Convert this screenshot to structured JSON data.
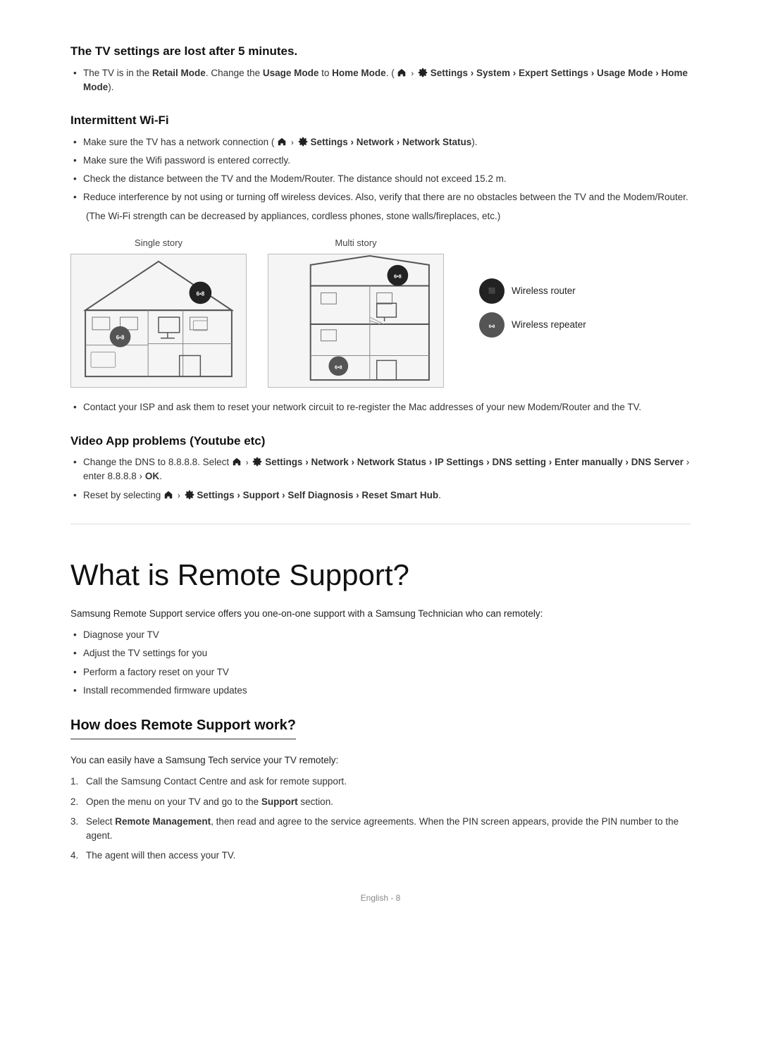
{
  "section_tv_settings": {
    "heading": "The TV settings are lost after 5 minutes.",
    "bullets": [
      {
        "text_parts": [
          {
            "text": "The TV is in the ",
            "bold": false
          },
          {
            "text": "Retail Mode",
            "bold": true
          },
          {
            "text": ". Change the ",
            "bold": false
          },
          {
            "text": "Usage Mode",
            "bold": true
          },
          {
            "text": " to ",
            "bold": false
          },
          {
            "text": "Home Mode",
            "bold": true
          },
          {
            "text": ". (",
            "bold": false
          },
          {
            "text": "home_icon",
            "icon": true
          },
          {
            "text": " > ",
            "bold": false
          },
          {
            "text": "settings_icon",
            "icon": true
          },
          {
            "text": " Settings > System > Expert Settings > Usage Mode > Home Mode",
            "bold": true
          },
          {
            "text": ").",
            "bold": false
          }
        ]
      }
    ]
  },
  "section_wifi": {
    "heading": "Intermittent Wi-Fi",
    "bullets": [
      "Make sure the TV has a network connection (home_icon > settings_icon Settings > Network > Network Status).",
      "Make sure the Wifi password is entered correctly.",
      "Check the distance between the TV and the Modem/Router. The distance should not exceed 15.2 m.",
      "Reduce interference by not using or turning off wireless devices. Also, verify that there are no obstacles between the TV and the Modem/Router."
    ],
    "note": "(The Wi-Fi strength can be decreased by appliances, cordless phones, stone walls/fireplaces, etc.)",
    "diagram": {
      "single_story_label": "Single story",
      "multi_story_label": "Multi story",
      "legend": {
        "wireless_router": "Wireless router",
        "wireless_repeater": "Wireless repeater"
      }
    },
    "isp_bullet": "Contact your ISP and ask them to reset your network circuit to re-register the Mac addresses of your new Modem/Router and the TV."
  },
  "section_video": {
    "heading": "Video App problems (Youtube etc)",
    "bullets": [
      {
        "type": "complex",
        "parts": [
          {
            "text": "Change the DNS to 8.8.8.8. Select ",
            "bold": false
          },
          {
            "text": "home_icon",
            "icon": true
          },
          {
            "text": " > ",
            "bold": false
          },
          {
            "text": "settings_icon",
            "icon": true
          },
          {
            "text": " Settings > Network > Network Status > IP Settings > DNS setting > Enter manually > DNS Server",
            "bold": true
          },
          {
            "text": " > enter 8.8.8.8 > ",
            "bold": false
          },
          {
            "text": "OK",
            "bold": true
          },
          {
            "text": ".",
            "bold": false
          }
        ]
      },
      {
        "type": "complex",
        "parts": [
          {
            "text": "Reset by selecting ",
            "bold": false
          },
          {
            "text": "home_icon",
            "icon": true
          },
          {
            "text": " > ",
            "bold": false
          },
          {
            "text": "settings_icon",
            "icon": true
          },
          {
            "text": " Settings > Support > Self Diagnosis > Reset Smart Hub",
            "bold": true
          },
          {
            "text": ".",
            "bold": false
          }
        ]
      }
    ]
  },
  "section_remote_support": {
    "heading": "What is Remote Support?",
    "intro": "Samsung Remote Support service offers you one-on-one support with a Samsung Technician who can remotely:",
    "bullets": [
      "Diagnose your TV",
      "Adjust the TV settings for you",
      "Perform a factory reset on your TV",
      "Install recommended firmware updates"
    ]
  },
  "section_how_works": {
    "heading": "How does Remote Support work?",
    "intro": "You can easily have a Samsung Tech service your TV remotely:",
    "steps": [
      "Call the Samsung Contact Centre and ask for remote support.",
      {
        "parts": [
          {
            "text": "Open the menu on your TV and go to the ",
            "bold": false
          },
          {
            "text": "Support",
            "bold": true
          },
          {
            "text": " section.",
            "bold": false
          }
        ]
      },
      {
        "parts": [
          {
            "text": "Select ",
            "bold": false
          },
          {
            "text": "Remote Management",
            "bold": true
          },
          {
            "text": ", then read and agree to the service agreements. When the PIN screen appears, provide the PIN number to the agent.",
            "bold": false
          }
        ]
      },
      "The agent will then access your TV."
    ]
  },
  "footer": {
    "text": "English - 8"
  }
}
